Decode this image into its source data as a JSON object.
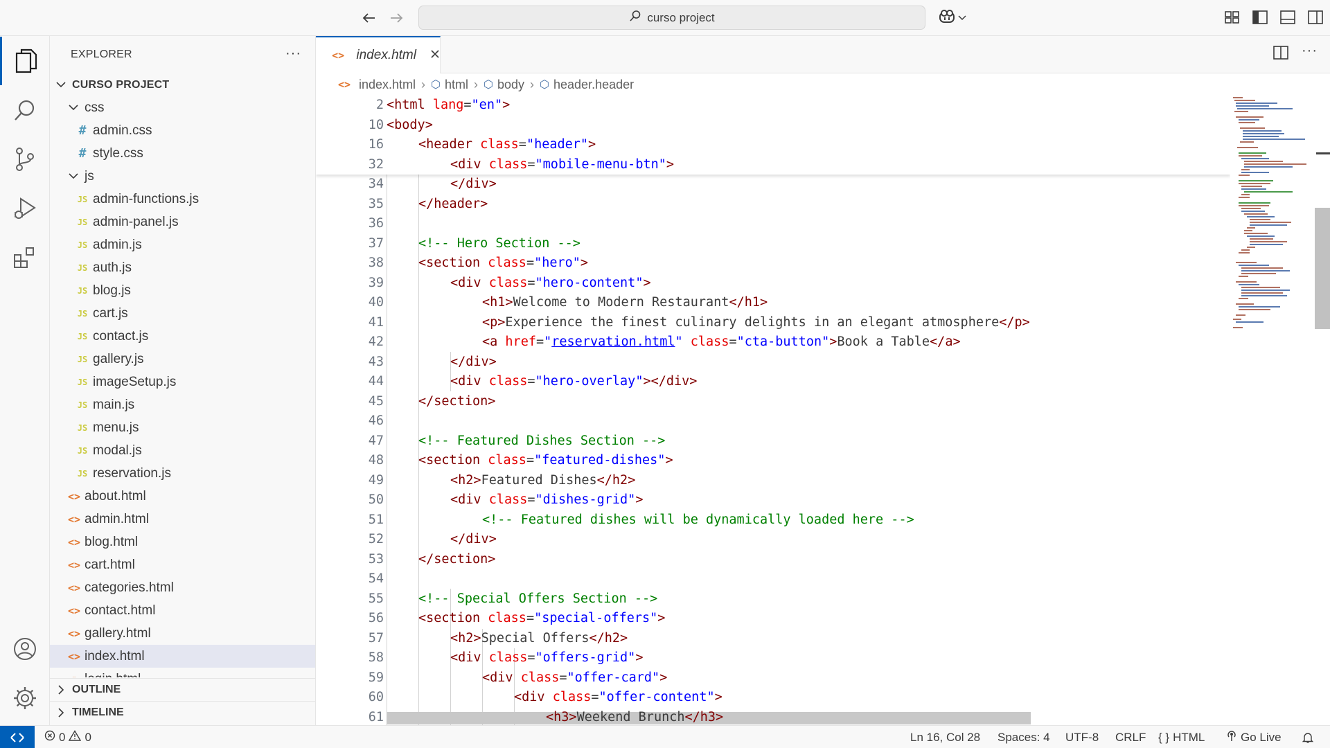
{
  "titlebar": {
    "search_text": "curso project"
  },
  "activity": {
    "items": [
      "explorer",
      "search",
      "source-control",
      "run-debug",
      "extensions",
      "accounts",
      "manage"
    ]
  },
  "sidebar": {
    "title": "EXPLORER",
    "more": "···",
    "root": "CURSO PROJECT",
    "folder_css": "css",
    "css_files": [
      "admin.css",
      "style.css"
    ],
    "folder_js": "js",
    "js_files": [
      "admin-functions.js",
      "admin-panel.js",
      "admin.js",
      "auth.js",
      "blog.js",
      "cart.js",
      "contact.js",
      "gallery.js",
      "imageSetup.js",
      "main.js",
      "menu.js",
      "modal.js",
      "reservation.js"
    ],
    "html_files": [
      "about.html",
      "admin.html",
      "blog.html",
      "cart.html",
      "categories.html",
      "contact.html",
      "gallery.html",
      "index.html",
      "login.html"
    ],
    "selected_file": "index.html",
    "outline": "OUTLINE",
    "timeline": "TIMELINE",
    "css_icon": "#",
    "js_icon": "JS",
    "html_icon": "<>"
  },
  "editor": {
    "tab_label": "index.html",
    "breadcrumb": [
      "index.html",
      "html",
      "body",
      "header.header"
    ],
    "sticky_numbers": [
      "2",
      "10",
      "16",
      "32"
    ],
    "line_numbers": [
      "34",
      "35",
      "36",
      "37",
      "38",
      "39",
      "40",
      "41",
      "42",
      "43",
      "44",
      "45",
      "46",
      "47",
      "48",
      "49",
      "50",
      "51",
      "52",
      "53",
      "54",
      "55",
      "56",
      "57",
      "58",
      "59",
      "60",
      "61"
    ]
  },
  "code": {
    "s2": [
      "<html",
      " lang",
      "=",
      "\"en\"",
      ">"
    ],
    "s10": "<body>",
    "s16": [
      "<header",
      " class",
      "=",
      "\"header\"",
      ">"
    ],
    "s32": [
      "<div",
      " class",
      "=",
      "\"mobile-menu-btn\"",
      ">"
    ],
    "l34": "</div>",
    "l35": "</header>",
    "l37": "<!-- Hero Section -->",
    "l38": [
      "<section",
      " class",
      "=",
      "\"hero\"",
      ">"
    ],
    "l39": [
      "<div",
      " class",
      "=",
      "\"hero-content\"",
      ">"
    ],
    "l40": [
      "<h1>",
      "Welcome to Modern Restaurant",
      "</h1>"
    ],
    "l41": [
      "<p>",
      "Experience the finest culinary delights in an elegant atmosphere",
      "</p>"
    ],
    "l42": [
      "<a",
      " href",
      "=",
      "\"",
      "reservation.html",
      "\"",
      " class",
      "=",
      "\"cta-button\"",
      ">",
      "Book a Table",
      "</a>"
    ],
    "l43": "</div>",
    "l44": [
      "<div",
      " class",
      "=",
      "\"hero-overlay\"",
      "></div>"
    ],
    "l45": "</section>",
    "l47": "<!-- Featured Dishes Section -->",
    "l48": [
      "<section",
      " class",
      "=",
      "\"featured-dishes\"",
      ">"
    ],
    "l49": [
      "<h2>",
      "Featured Dishes",
      "</h2>"
    ],
    "l50": [
      "<div",
      " class",
      "=",
      "\"dishes-grid\"",
      ">"
    ],
    "l51": "<!-- Featured dishes will be dynamically loaded here -->",
    "l52": "</div>",
    "l53": "</section>",
    "l55": "<!-- Special Offers Section -->",
    "l56": [
      "<section",
      " class",
      "=",
      "\"special-offers\"",
      ">"
    ],
    "l57": [
      "<h2>",
      "Special Offers",
      "</h2>"
    ],
    "l58": [
      "<div",
      " class",
      "=",
      "\"offers-grid\"",
      ">"
    ],
    "l59": [
      "<div",
      " class",
      "=",
      "\"offer-card\"",
      ">"
    ],
    "l60": [
      "<div",
      " class",
      "=",
      "\"offer-content\"",
      ">"
    ],
    "l61": [
      "<h3>",
      "Weekend Brunch",
      "</h3>"
    ]
  },
  "status": {
    "errors": "0",
    "warnings": "0",
    "position": "Ln 16, Col 28",
    "spaces": "Spaces: 4",
    "encoding": "UTF-8",
    "eol": "CRLF",
    "language_icon": "{ }",
    "language": "HTML",
    "golive": "Go Live"
  },
  "colors": {
    "accent": "#005fb8",
    "tag": "#800000",
    "attr": "#e50000",
    "value": "#0000ff",
    "comment": "#008000",
    "selected_row": "#e4e6f1"
  }
}
